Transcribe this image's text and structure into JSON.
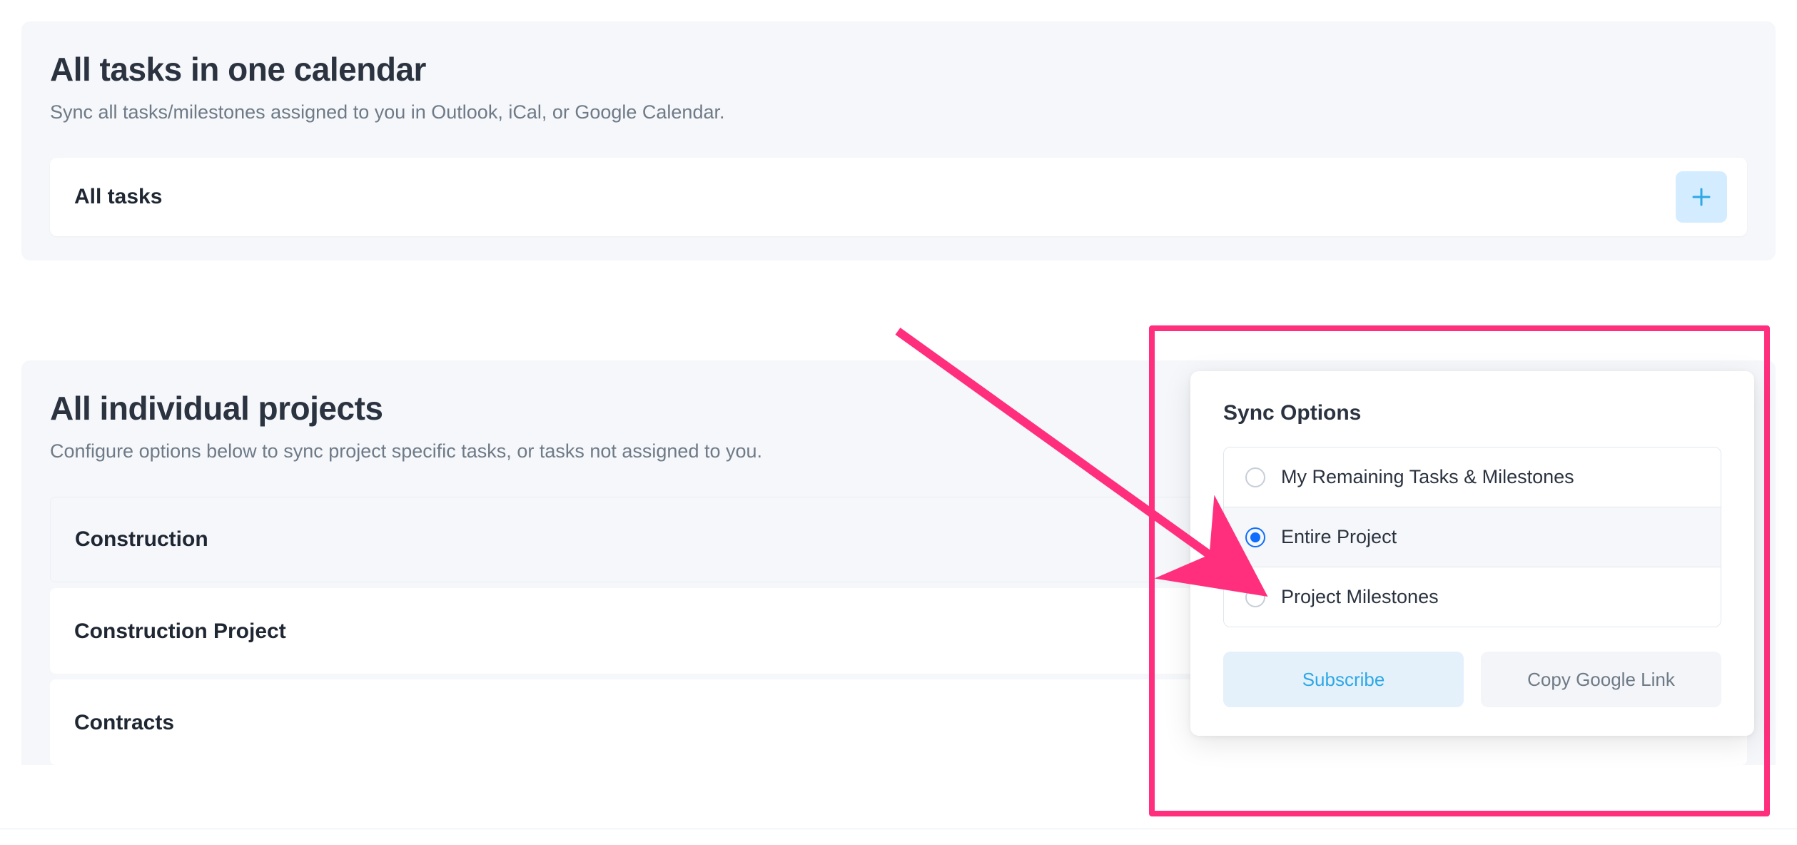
{
  "top": {
    "heading": "All tasks in one calendar",
    "sub": "Sync all tasks/milestones assigned to you in Outlook, iCal, or Google Calendar.",
    "row_label": "All tasks"
  },
  "projects": {
    "heading": "All individual projects",
    "sub": "Configure options below to sync project specific tasks, or tasks not assigned to you.",
    "items": [
      {
        "label": "Construction"
      },
      {
        "label": "Construction Project"
      },
      {
        "label": "Contracts"
      }
    ]
  },
  "popover": {
    "title": "Sync Options",
    "options": [
      {
        "label": "My Remaining Tasks & Milestones"
      },
      {
        "label": "Entire Project"
      },
      {
        "label": "Project Milestones"
      }
    ],
    "subscribe": "Subscribe",
    "copy": "Copy Google Link"
  }
}
